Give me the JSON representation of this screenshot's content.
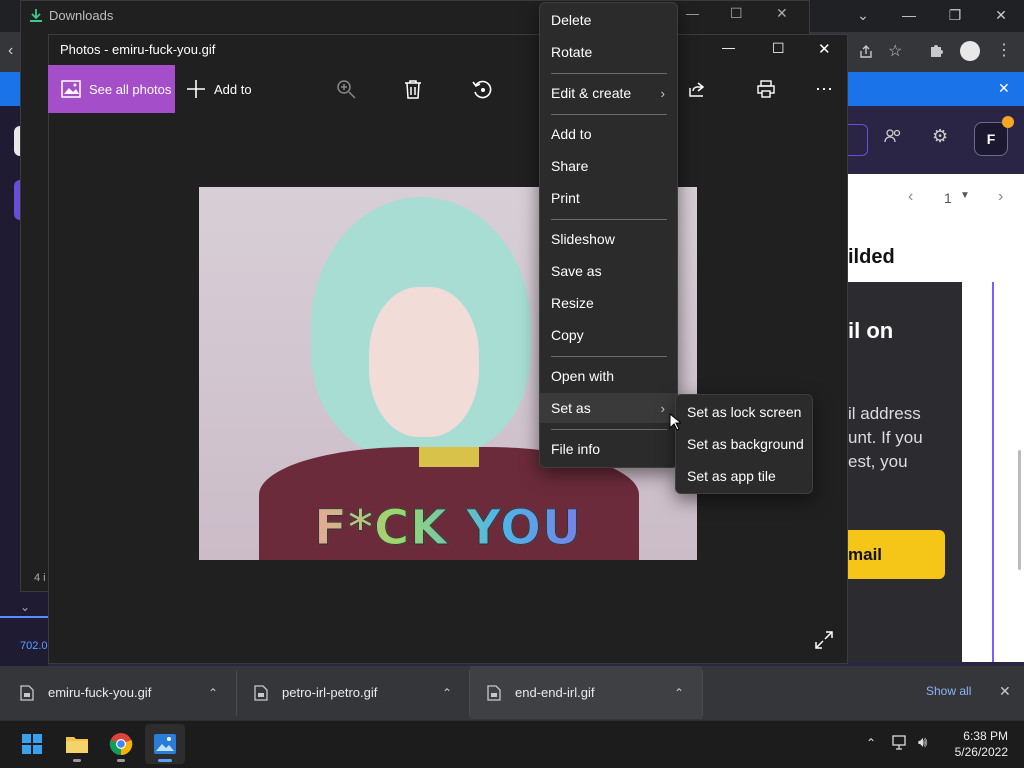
{
  "explorer": {
    "title": "Downloads",
    "status_count": "4 i",
    "status_size": "702.0"
  },
  "photos": {
    "title": "Photos - emiru-fuck-you.gif",
    "see_all_label": "See all photos",
    "add_to_label": "Add to",
    "image_text": "F*CK YOU"
  },
  "context_menu": {
    "items": [
      "Delete",
      "Rotate",
      "Edit & create",
      "Add to",
      "Share",
      "Print",
      "Slideshow",
      "Save as",
      "Resize",
      "Copy",
      "Open with",
      "Set as",
      "File info"
    ]
  },
  "submenu": {
    "items": [
      "Set as lock screen",
      "Set as background",
      "Set as app tile"
    ]
  },
  "web": {
    "avatar_letter": "F",
    "page_number": "1",
    "heading": "ilded",
    "big_text": "il on",
    "body_lines": [
      "il address",
      "unt. If you",
      "est, you"
    ],
    "button_label": "mail"
  },
  "downloads": {
    "items": [
      "emiru-fuck-you.gif",
      "petro-irl-petro.gif",
      "end-end-irl.gif"
    ],
    "show_all": "Show all"
  },
  "taskbar": {
    "time": "6:38 PM",
    "date": "5/26/2022"
  },
  "colors": {
    "photos_accent": "#a54ec9",
    "chrome_infobar": "#1a73e8",
    "web_button": "#f5c518"
  }
}
